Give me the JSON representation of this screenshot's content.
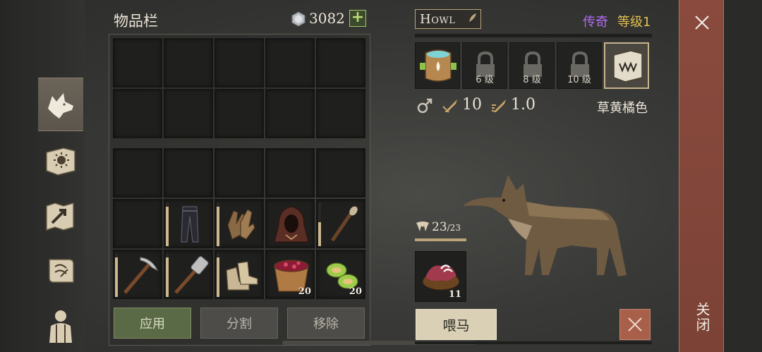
{
  "inventory": {
    "title": "物品栏",
    "currency": "3082",
    "plus_label": "+",
    "grid_top": [
      {
        "item": null
      },
      {
        "item": null
      },
      {
        "item": null
      },
      {
        "item": null
      },
      {
        "item": null
      },
      {
        "item": null
      },
      {
        "item": null
      },
      {
        "item": null
      },
      {
        "item": null
      },
      {
        "item": null
      }
    ],
    "grid_bottom": [
      {
        "item": null,
        "durability": null,
        "qty": ""
      },
      {
        "item": null,
        "durability": null,
        "qty": ""
      },
      {
        "item": null,
        "durability": null,
        "qty": ""
      },
      {
        "item": null,
        "durability": null,
        "qty": ""
      },
      {
        "item": null,
        "durability": null,
        "qty": ""
      },
      {
        "item": null,
        "durability": null,
        "qty": ""
      },
      {
        "item": "pants-icon",
        "durability": 0.9,
        "qty": ""
      },
      {
        "item": "gloves-icon",
        "durability": 0.9,
        "qty": ""
      },
      {
        "item": "hood-icon",
        "durability": 0.9,
        "qty": ""
      },
      {
        "item": "torch-icon",
        "durability": 0.55,
        "qty": ""
      },
      {
        "item": "pickaxe-icon",
        "durability": 0.9,
        "qty": ""
      },
      {
        "item": "hammer-icon",
        "durability": 0.9,
        "qty": ""
      },
      {
        "item": "boots-icon",
        "durability": 0.9,
        "qty": ""
      },
      {
        "item": "berry-bowl-icon",
        "durability": null,
        "qty": "20"
      },
      {
        "item": "cooked-food-icon",
        "durability": null,
        "qty": "20"
      }
    ],
    "buttons": {
      "apply": "应用",
      "split": "分割",
      "remove": "移除"
    }
  },
  "pet": {
    "name": "Howl",
    "rarity": "传奇",
    "level": "等级1",
    "slots": [
      {
        "icon": "saddlebag-icon",
        "label": ""
      },
      {
        "icon": "lock-icon",
        "label": "6 级"
      },
      {
        "icon": "lock-icon",
        "label": "8 级"
      },
      {
        "icon": "lock-icon",
        "label": "10 级"
      },
      {
        "icon": "fang-book-icon",
        "label": ""
      }
    ],
    "attack": "10",
    "speed": "1.0",
    "coat_color": "草黄橘色",
    "food_current": "23",
    "food_max": "/23",
    "feed_item_qty": "11",
    "feed_button": "喂马"
  },
  "close_label": "关闭",
  "colors": {
    "rarity": "#b06cf2",
    "level": "#e2c04f",
    "accent": "#b9a57a",
    "close": "#8a4b3e"
  }
}
